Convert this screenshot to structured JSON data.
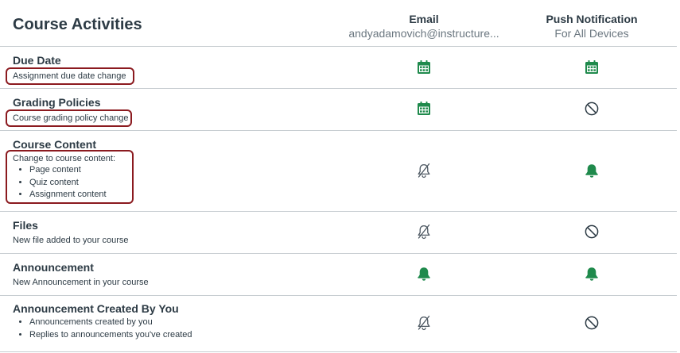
{
  "header": {
    "title": "Course Activities",
    "email_label": "Email",
    "email_address": "andyadamovich@instructure...",
    "push_label": "Push Notification",
    "push_sub": "For All Devices"
  },
  "icons": {
    "calendar": "calendar-icon",
    "bell": "bell-icon",
    "bell_off": "bell-off-icon",
    "not_allowed": "no-icon"
  },
  "colors": {
    "green": "#1f8a4c",
    "gray": "#4b5660",
    "highlight": "#8b1a1f"
  },
  "rows": [
    {
      "title": "Due Date",
      "description": "Assignment due date change",
      "email": "calendar",
      "push": "calendar"
    },
    {
      "title": "Grading Policies",
      "description": "Course grading policy change",
      "email": "calendar",
      "push": "not_allowed"
    },
    {
      "title": "Course Content",
      "description": "Change to course content:",
      "bullets": [
        "Page content",
        "Quiz content",
        "Assignment content"
      ],
      "email": "bell_off",
      "push": "bell"
    },
    {
      "title": "Files",
      "description": "New file added to your course",
      "email": "bell_off",
      "push": "not_allowed"
    },
    {
      "title": "Announcement",
      "description": "New Announcement in your course",
      "email": "bell",
      "push": "bell"
    },
    {
      "title": "Announcement Created By You",
      "bullets": [
        "Announcements created by you",
        "Replies to announcements you've created"
      ],
      "email": "bell_off",
      "push": "not_allowed"
    }
  ]
}
